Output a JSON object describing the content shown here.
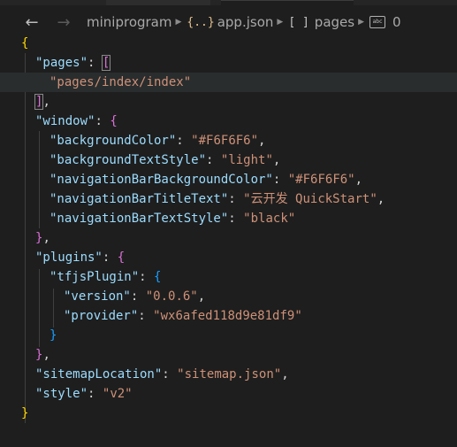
{
  "breadcrumb": {
    "items": [
      {
        "icon": "folder",
        "label": "miniprogram"
      },
      {
        "icon": "{..}",
        "label": "app.json"
      },
      {
        "icon": "[ ]",
        "label": "pages"
      },
      {
        "icon": "abc",
        "label": "0"
      }
    ]
  },
  "code": {
    "open_brace": "{",
    "pages_key": "\"pages\"",
    "colon": ":",
    "comma": ",",
    "open_bracket": "[",
    "close_bracket": "]",
    "pages_value": "\"pages/index/index\"",
    "window_key": "\"window\"",
    "bg_color_key": "\"backgroundColor\"",
    "bg_color_val": "\"#F6F6F6\"",
    "bg_text_style_key": "\"backgroundTextStyle\"",
    "bg_text_style_val": "\"light\"",
    "nav_bg_key": "\"navigationBarBackgroundColor\"",
    "nav_bg_val": "\"#F6F6F6\"",
    "nav_title_key": "\"navigationBarTitleText\"",
    "nav_title_val": "\"云开发 QuickStart\"",
    "nav_text_style_key": "\"navigationBarTextStyle\"",
    "nav_text_style_val": "\"black\"",
    "close_brace": "}",
    "plugins_key": "\"plugins\"",
    "tfjs_key": "\"tfjsPlugin\"",
    "version_key": "\"version\"",
    "version_val": "\"0.0.6\"",
    "provider_key": "\"provider\"",
    "provider_val": "\"wx6afed118d9e81df9\"",
    "sitemap_key": "\"sitemapLocation\"",
    "sitemap_val": "\"sitemap.json\"",
    "style_key": "\"style\"",
    "style_val": "\"v2\""
  },
  "colors": {
    "editor_bg": "#1e1e1e",
    "key": "#9cdcfe",
    "string": "#ce9178",
    "bracket_gold": "#ffd700",
    "bracket_orchid": "#da70d6",
    "bracket_blue": "#179fff"
  }
}
